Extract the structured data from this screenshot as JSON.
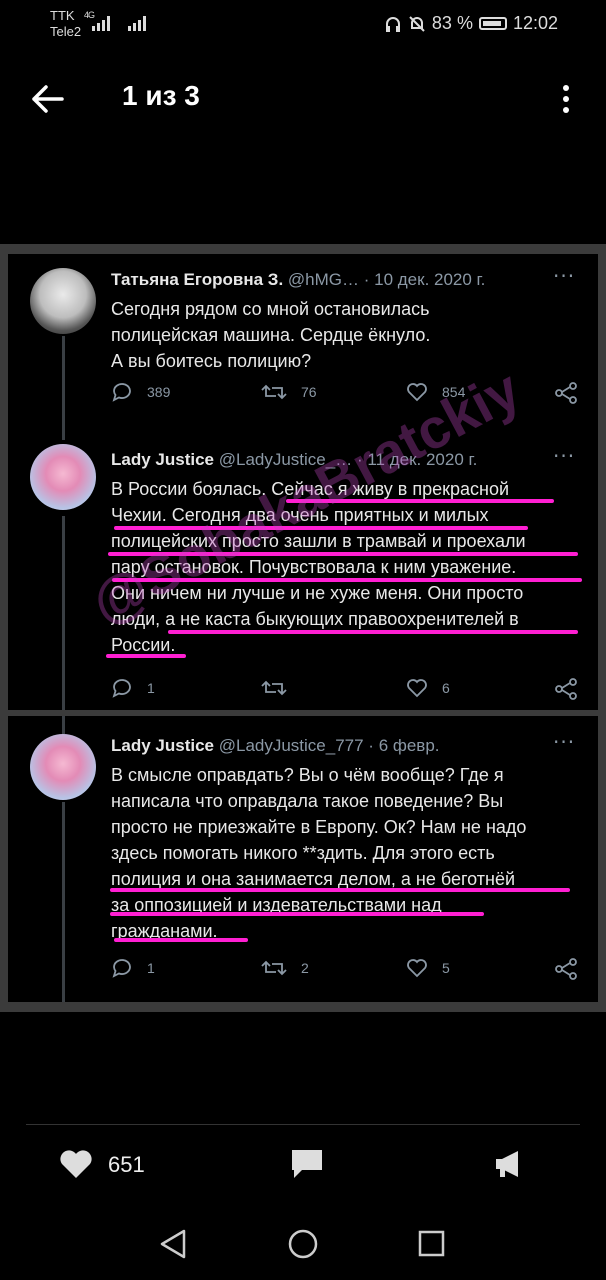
{
  "status_bar": {
    "carrier1": "TTK",
    "carrier2": "Tele2",
    "network": "4G",
    "battery": "83 %",
    "time": "12:02"
  },
  "header": {
    "counter": "1 из 3"
  },
  "tweets": [
    {
      "name": "Татьяна Егоровна З.",
      "handle": "@hMG… · 10 дек. 2020 г.",
      "lines": [
        "Сегодня рядом со мной остановилась",
        "полицейская машина. Сердце ёкнуло.",
        "А вы боитесь полицию?"
      ],
      "replies": "389",
      "retweets": "76",
      "likes": "854"
    },
    {
      "name": "Lady Justice",
      "handle": "@LadyJustice_… · 11 дек. 2020 г.",
      "lines": [
        "В России боялась. Сейчас я живу в прекрасной",
        "Чехии. Сегодня два очень приятных и милых",
        "полицейских просто зашли в трамвай и проехали",
        "пару остановок. Почувствовала к ним уважение.",
        "Они ничем ни лучше и не хуже меня. Они просто",
        "люди, а не каста быкующих правоохренителей в",
        "России."
      ],
      "replies": "1",
      "retweets": "",
      "likes": "6"
    },
    {
      "name": "Lady Justice",
      "handle": "@LadyJustice_777 · 6 февр.",
      "lines": [
        "В смысле оправдать? Вы о чём вообще? Где я",
        "написала что оправдала такое поведение? Вы",
        "просто не приезжайте в Европу. Ок? Нам не надо",
        "здесь помогать никого **здить. Для этого есть",
        "полиция и она занимается делом, а не беготнёй",
        "за оппозицией и издевательствами над",
        "гражданами."
      ],
      "replies": "1",
      "retweets": "2",
      "likes": "5"
    }
  ],
  "watermark": "@SobakaBratckiy",
  "footer": {
    "like_count": "651"
  },
  "colors": {
    "highlight": "#ff1fd2",
    "background": "#000000",
    "muted": "#8b98a5"
  }
}
